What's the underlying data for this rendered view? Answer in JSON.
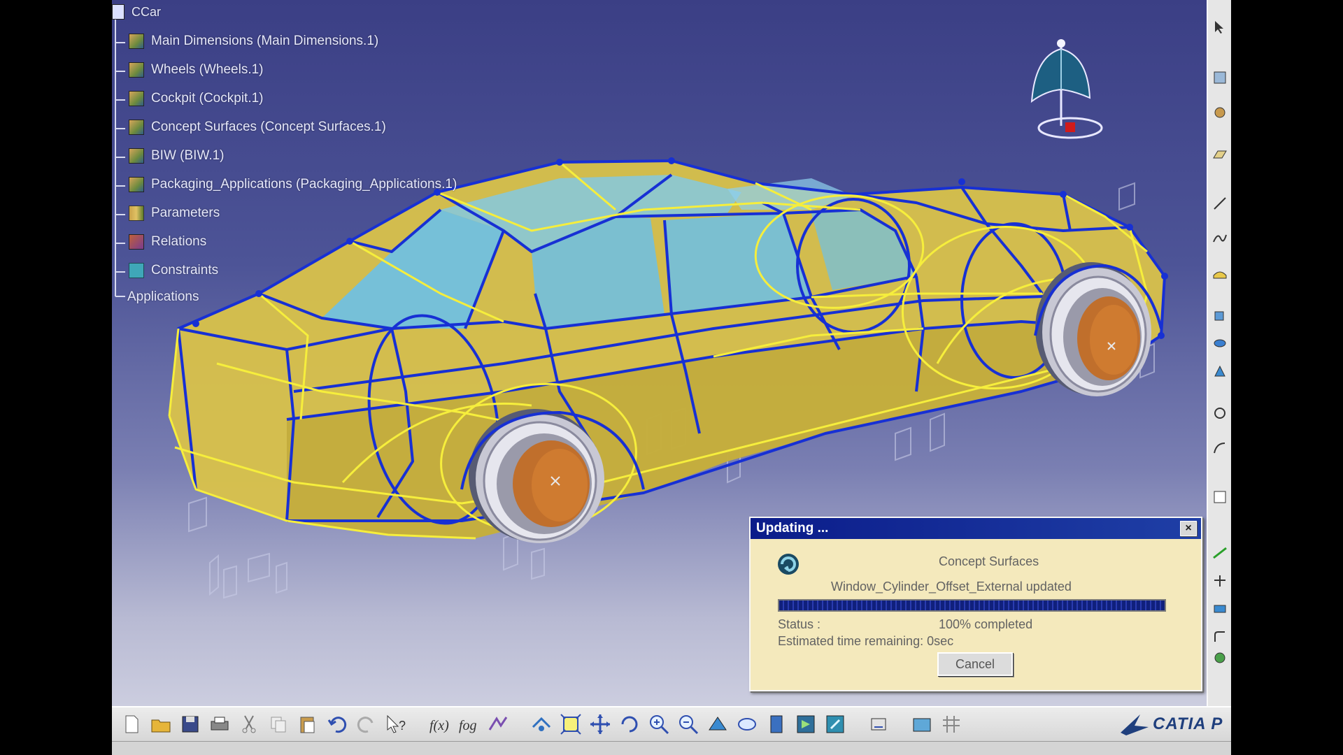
{
  "spec_tree": {
    "root_label": "CCar",
    "items": [
      {
        "label": "Main Dimensions (Main Dimensions.1)",
        "icon": "part-body-icon"
      },
      {
        "label": "Wheels (Wheels.1)",
        "icon": "part-body-icon"
      },
      {
        "label": "Cockpit (Cockpit.1)",
        "icon": "part-body-icon"
      },
      {
        "label": "Concept Surfaces (Concept Surfaces.1)",
        "icon": "part-body-icon"
      },
      {
        "label": "BIW (BIW.1)",
        "icon": "part-body-icon"
      },
      {
        "label": "Packaging_Applications (Packaging_Applications.1)",
        "icon": "part-body-icon"
      },
      {
        "label": "Parameters",
        "icon": "parameters-icon"
      },
      {
        "label": "Relations",
        "icon": "relations-icon"
      },
      {
        "label": "Constraints",
        "icon": "constraints-icon"
      },
      {
        "label": "Applications",
        "icon": "none"
      }
    ]
  },
  "dialog": {
    "title": "Updating ...",
    "object": "Concept Surfaces",
    "message": "Window_Cylinder_Offset_External updated",
    "status_label": "Status :",
    "status_value": "100% completed",
    "remaining": "Estimated time remaining: 0sec",
    "cancel_label": "Cancel",
    "progress": 1.0,
    "close_glyph": "×"
  },
  "brand": {
    "text": "CATIA P"
  },
  "colors": {
    "background_top": "#3b3f85",
    "body_yellow": "#d9c24a",
    "wire_blue": "#1730d4",
    "wire_yellow": "#f6ee3c",
    "glass": "#6cc0e8",
    "dialog_bg": "#f4e9bc",
    "titlebar": "#0b1c8a"
  },
  "toolbar_icons": [
    "new-icon",
    "open-icon",
    "save-icon",
    "print-icon",
    "cut-icon",
    "copy-icon",
    "paste-icon",
    "undo-icon",
    "redo-icon",
    "whats-this-icon",
    "formula-icon",
    "formula-edit-icon",
    "knowledge-icon",
    "fly-icon",
    "fit-all-icon",
    "pan-icon",
    "rotate-icon",
    "zoom-in-icon",
    "zoom-out-icon",
    "normal-view-icon",
    "views-icon",
    "render-style-icon",
    "hide-show-icon",
    "swap-visible-icon",
    "measure-icon",
    "catalog-icon",
    "grid-icon"
  ],
  "right_toolbar_icons": [
    "select-icon",
    "sketch-icon",
    "part-icon",
    "plane-icon",
    "line-icon",
    "spline-icon",
    "surface-icon",
    "extrude-icon",
    "revolve-icon",
    "circle-icon",
    "sweep-icon",
    "fill-icon",
    "blend-icon",
    "offset-icon",
    "join-icon",
    "split-icon",
    "trim-icon",
    "fillet-icon",
    "translate-icon",
    "analysis-icon"
  ]
}
